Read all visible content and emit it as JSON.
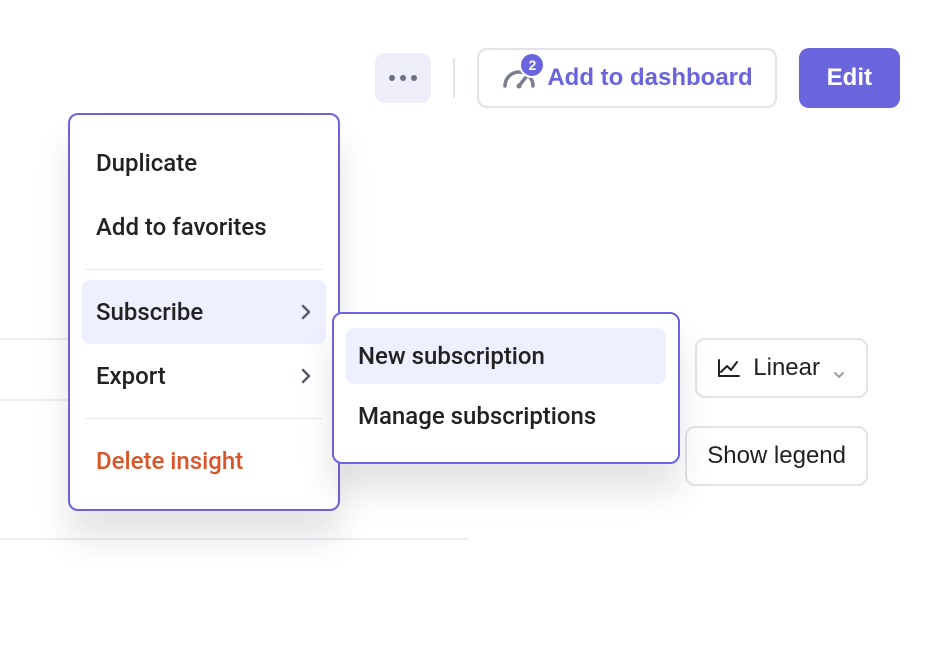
{
  "toolbar": {
    "dashboard_badge": "2",
    "dashboard_label": "Add to dashboard",
    "edit_label": "Edit"
  },
  "bg": {
    "scale_label": "Linear",
    "legend_label": "Show legend"
  },
  "menu": {
    "duplicate": "Duplicate",
    "favorites": "Add to favorites",
    "subscribe": "Subscribe",
    "export": "Export",
    "delete": "Delete insight"
  },
  "submenu": {
    "new": "New subscription",
    "manage": "Manage subscriptions"
  }
}
